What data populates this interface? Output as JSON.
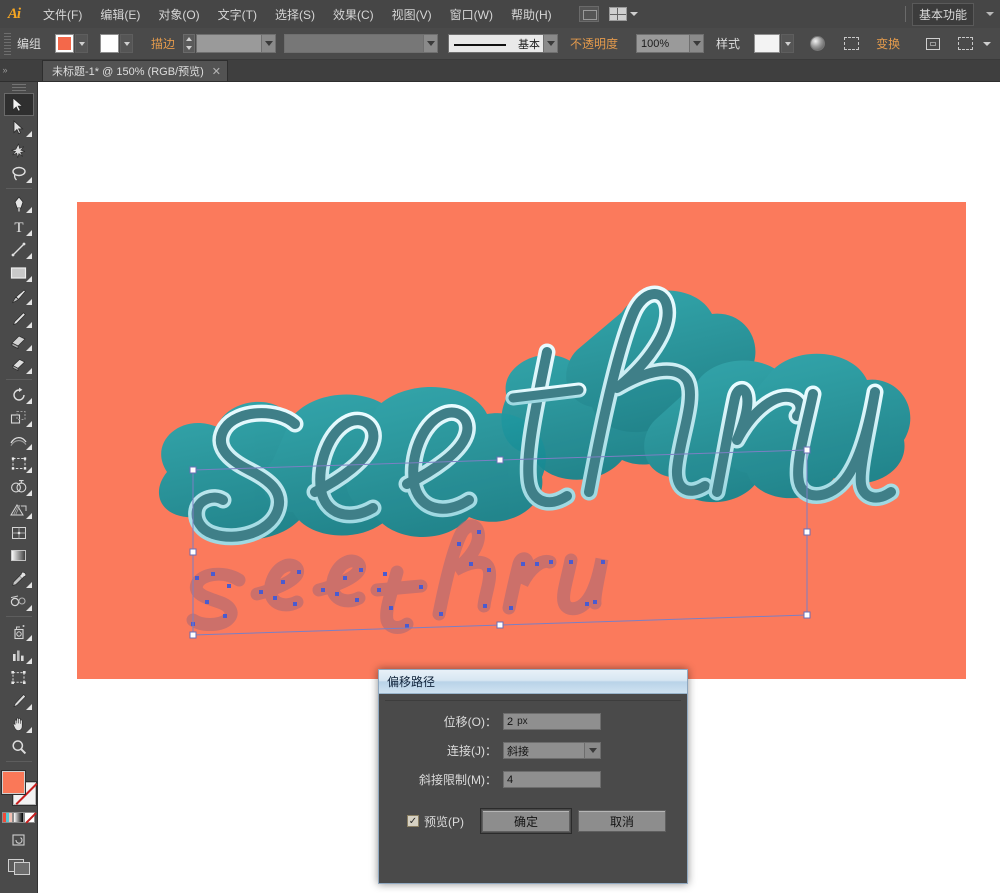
{
  "app": {
    "logo": "Ai",
    "menus": [
      {
        "label": "文件(F)"
      },
      {
        "label": "编辑(E)"
      },
      {
        "label": "对象(O)"
      },
      {
        "label": "文字(T)"
      },
      {
        "label": "选择(S)"
      },
      {
        "label": "效果(C)"
      },
      {
        "label": "视图(V)"
      },
      {
        "label": "窗口(W)"
      },
      {
        "label": "帮助(H)"
      }
    ],
    "workspace": "基本功能"
  },
  "control_bar": {
    "selection_label": "编组",
    "fill_color": "#f4684a",
    "stroke_label": "描边",
    "stroke_weight": "",
    "brush_label": "基本",
    "opacity_label": "不透明度",
    "opacity_value": "100%",
    "style_label": "样式",
    "transform_label": "变换"
  },
  "document": {
    "tab_title": "未标题-1* @ 150% (RGB/预览)",
    "close_glyph": "✕"
  },
  "toolbar": {
    "fill_color": "#fa7858",
    "stroke_color": "#ffffff",
    "tools": [
      {
        "name": "selection-tool",
        "glyph": "selection"
      },
      {
        "name": "direct-selection-tool",
        "glyph": "direct"
      },
      {
        "name": "magic-wand-tool",
        "glyph": "wand"
      },
      {
        "name": "lasso-tool",
        "glyph": "lasso"
      },
      {
        "name": "pen-tool",
        "glyph": "pen"
      },
      {
        "name": "type-tool",
        "glyph": "T"
      },
      {
        "name": "line-segment-tool",
        "glyph": "line"
      },
      {
        "name": "rectangle-tool",
        "glyph": "rect"
      },
      {
        "name": "paintbrush-tool",
        "glyph": "brush"
      },
      {
        "name": "pencil-tool",
        "glyph": "pencil"
      },
      {
        "name": "blob-brush-tool",
        "glyph": "blob"
      },
      {
        "name": "eraser-tool",
        "glyph": "eraser"
      },
      {
        "name": "rotate-tool",
        "glyph": "rotate"
      },
      {
        "name": "scale-tool",
        "glyph": "scale"
      },
      {
        "name": "width-tool",
        "glyph": "width"
      },
      {
        "name": "free-transform-tool",
        "glyph": "freetransform"
      },
      {
        "name": "shape-builder-tool",
        "glyph": "shapebuilder"
      },
      {
        "name": "perspective-grid-tool",
        "glyph": "perspective"
      },
      {
        "name": "mesh-tool",
        "glyph": "mesh"
      },
      {
        "name": "gradient-tool",
        "glyph": "gradient"
      },
      {
        "name": "eyedropper-tool",
        "glyph": "eyedropper"
      },
      {
        "name": "blend-tool",
        "glyph": "blend"
      },
      {
        "name": "symbol-sprayer-tool",
        "glyph": "symbol"
      },
      {
        "name": "column-graph-tool",
        "glyph": "graph"
      },
      {
        "name": "artboard-tool",
        "glyph": "artboard"
      },
      {
        "name": "slice-tool",
        "glyph": "slice"
      },
      {
        "name": "hand-tool",
        "glyph": "hand"
      },
      {
        "name": "zoom-tool",
        "glyph": "zoom"
      }
    ]
  },
  "artwork": {
    "background_color": "#fb7a5c",
    "text_line_1": "see",
    "text_line_2": "thru",
    "letter_fill": "#1f9aa3",
    "letter_shade": "#17848d",
    "letter_outline": "#cdeef2",
    "shadow_fill": "#b06b74",
    "anchor_color": "#4a5bd0",
    "selection_stroke": "#7b7fc4"
  },
  "dialog": {
    "title": "偏移路径",
    "fields": [
      {
        "label": "位移(O)：",
        "value": "2",
        "unit": "px"
      },
      {
        "label": "连接(J)：",
        "value": "斜接"
      },
      {
        "label": "斜接限制(M)：",
        "value": "4"
      }
    ],
    "preview_label": "预览(P)",
    "preview_checked": "✓",
    "ok_label": "确定",
    "cancel_label": "取消"
  }
}
